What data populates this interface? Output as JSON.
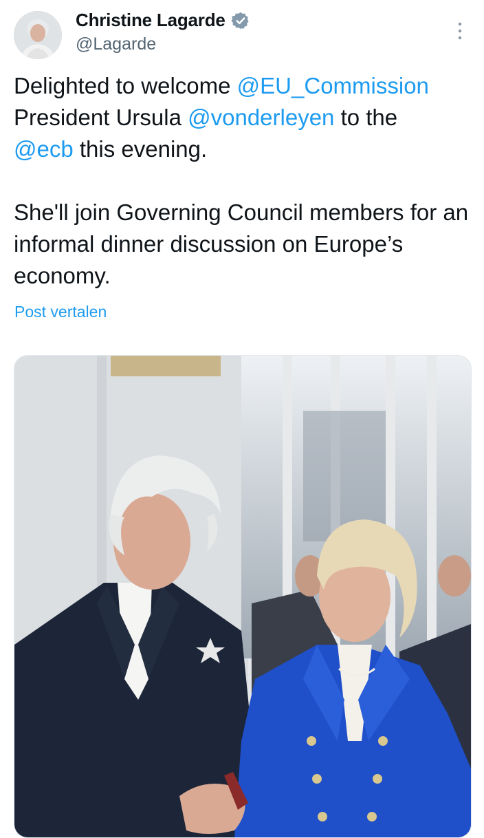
{
  "author": {
    "display_name": "Christine Lagarde",
    "handle": "@Lagarde",
    "verified_icon": "verified-badge-icon"
  },
  "tweet": {
    "p1": {
      "mention1": "@EU_Commission",
      "mention2": "@vonderleyen",
      "mention3": "@ecb",
      "t1": "Delighted to welcome ",
      "t2": "President Ursula ",
      "t3": " to the",
      "t4": " this evening."
    },
    "p2": "She'll join Governing Council members for an informal dinner discussion on Europe’s economy."
  },
  "translate_label": "Post vertalen",
  "colors": {
    "link": "#1d9bf0",
    "text": "#0f1419",
    "muted": "#536471",
    "lagarde_jacket": "#1c2638",
    "vdl_jacket": "#1f4fc9"
  }
}
